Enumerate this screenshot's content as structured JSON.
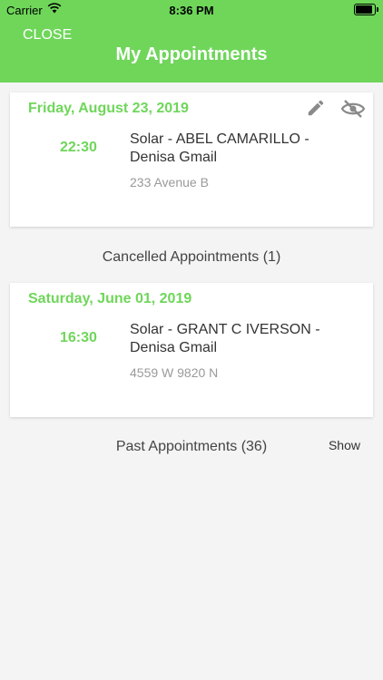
{
  "status_bar": {
    "carrier": "Carrier",
    "time": "8:36 PM",
    "battery_level": 1.0
  },
  "header": {
    "close_label": "CLOSE",
    "title": "My Appointments"
  },
  "upcoming": [
    {
      "date": "Friday, August 23, 2019",
      "time": "22:30",
      "title_line1": "Solar - ABEL CAMARILLO -",
      "title_line2": "Denisa Gmail",
      "address": "233 Avenue B"
    }
  ],
  "cancelled_section": {
    "label": "Cancelled Appointments (1)"
  },
  "cancelled": [
    {
      "date": "Saturday, June 01, 2019",
      "time": "16:30",
      "title_line1": "Solar - GRANT C IVERSON -",
      "title_line2": "Denisa Gmail",
      "address": "4559 W 9820 N"
    }
  ],
  "past_section": {
    "label": "Past Appointments (36)",
    "show_label": "Show"
  },
  "colors": {
    "accent": "#6fd65a",
    "icon_gray": "#8a8a8a"
  }
}
